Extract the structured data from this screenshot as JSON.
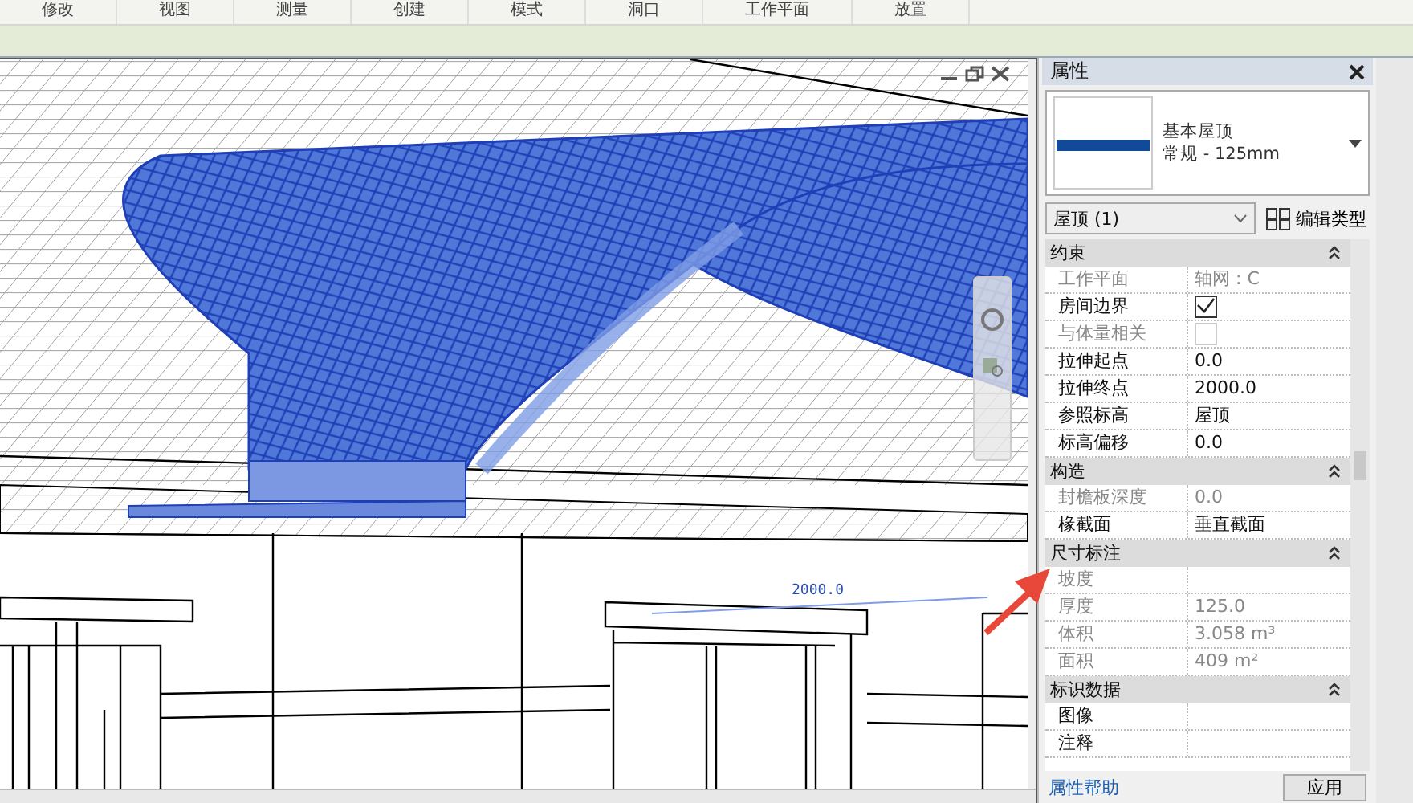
{
  "ribbon": {
    "panel_labels": [
      "修改",
      "视图",
      "测量",
      "创建",
      "模式",
      "洞口",
      "工作平面",
      "放置"
    ]
  },
  "viewport": {
    "dimension": "2000.0"
  },
  "properties": {
    "title": "属性",
    "type_name": "基本屋顶",
    "type_detail": "常规 - 125mm",
    "selector": "屋顶 (1)",
    "edit_type": "编辑类型",
    "groups": [
      {
        "name": "约束",
        "expanded": true,
        "rows": [
          {
            "label": "工作平面",
            "kind": "text",
            "value": "轴网 : C",
            "disabled": true
          },
          {
            "label": "房间边界",
            "kind": "checkbox",
            "checked": true,
            "disabled": false
          },
          {
            "label": "与体量相关",
            "kind": "checkbox",
            "checked": false,
            "disabled": true
          },
          {
            "label": "拉伸起点",
            "kind": "text",
            "value": "0.0",
            "disabled": false
          },
          {
            "label": "拉伸终点",
            "kind": "text",
            "value": "2000.0",
            "disabled": false
          },
          {
            "label": "参照标高",
            "kind": "text",
            "value": "屋顶",
            "disabled": false
          },
          {
            "label": "标高偏移",
            "kind": "text",
            "value": "0.0",
            "disabled": false
          }
        ]
      },
      {
        "name": "构造",
        "expanded": true,
        "rows": [
          {
            "label": "封檐板深度",
            "kind": "text",
            "value": "0.0",
            "disabled": true
          },
          {
            "label": "椽截面",
            "kind": "text",
            "value": "垂直截面",
            "disabled": false
          }
        ]
      },
      {
        "name": "尺寸标注",
        "expanded": true,
        "rows": [
          {
            "label": "坡度",
            "kind": "text",
            "value": "",
            "disabled": true
          },
          {
            "label": "厚度",
            "kind": "text",
            "value": "125.0",
            "disabled": true
          },
          {
            "label": "体积",
            "kind": "text",
            "value": "3.058 m³",
            "disabled": true
          },
          {
            "label": "面积",
            "kind": "text",
            "value": "409 m²",
            "disabled": true
          }
        ]
      },
      {
        "name": "标识数据",
        "expanded": true,
        "rows": [
          {
            "label": "图像",
            "kind": "text",
            "value": "",
            "disabled": false
          },
          {
            "label": "注释",
            "kind": "text",
            "value": "",
            "disabled": false
          }
        ]
      }
    ],
    "help_link": "属性帮助",
    "apply": "应用"
  }
}
